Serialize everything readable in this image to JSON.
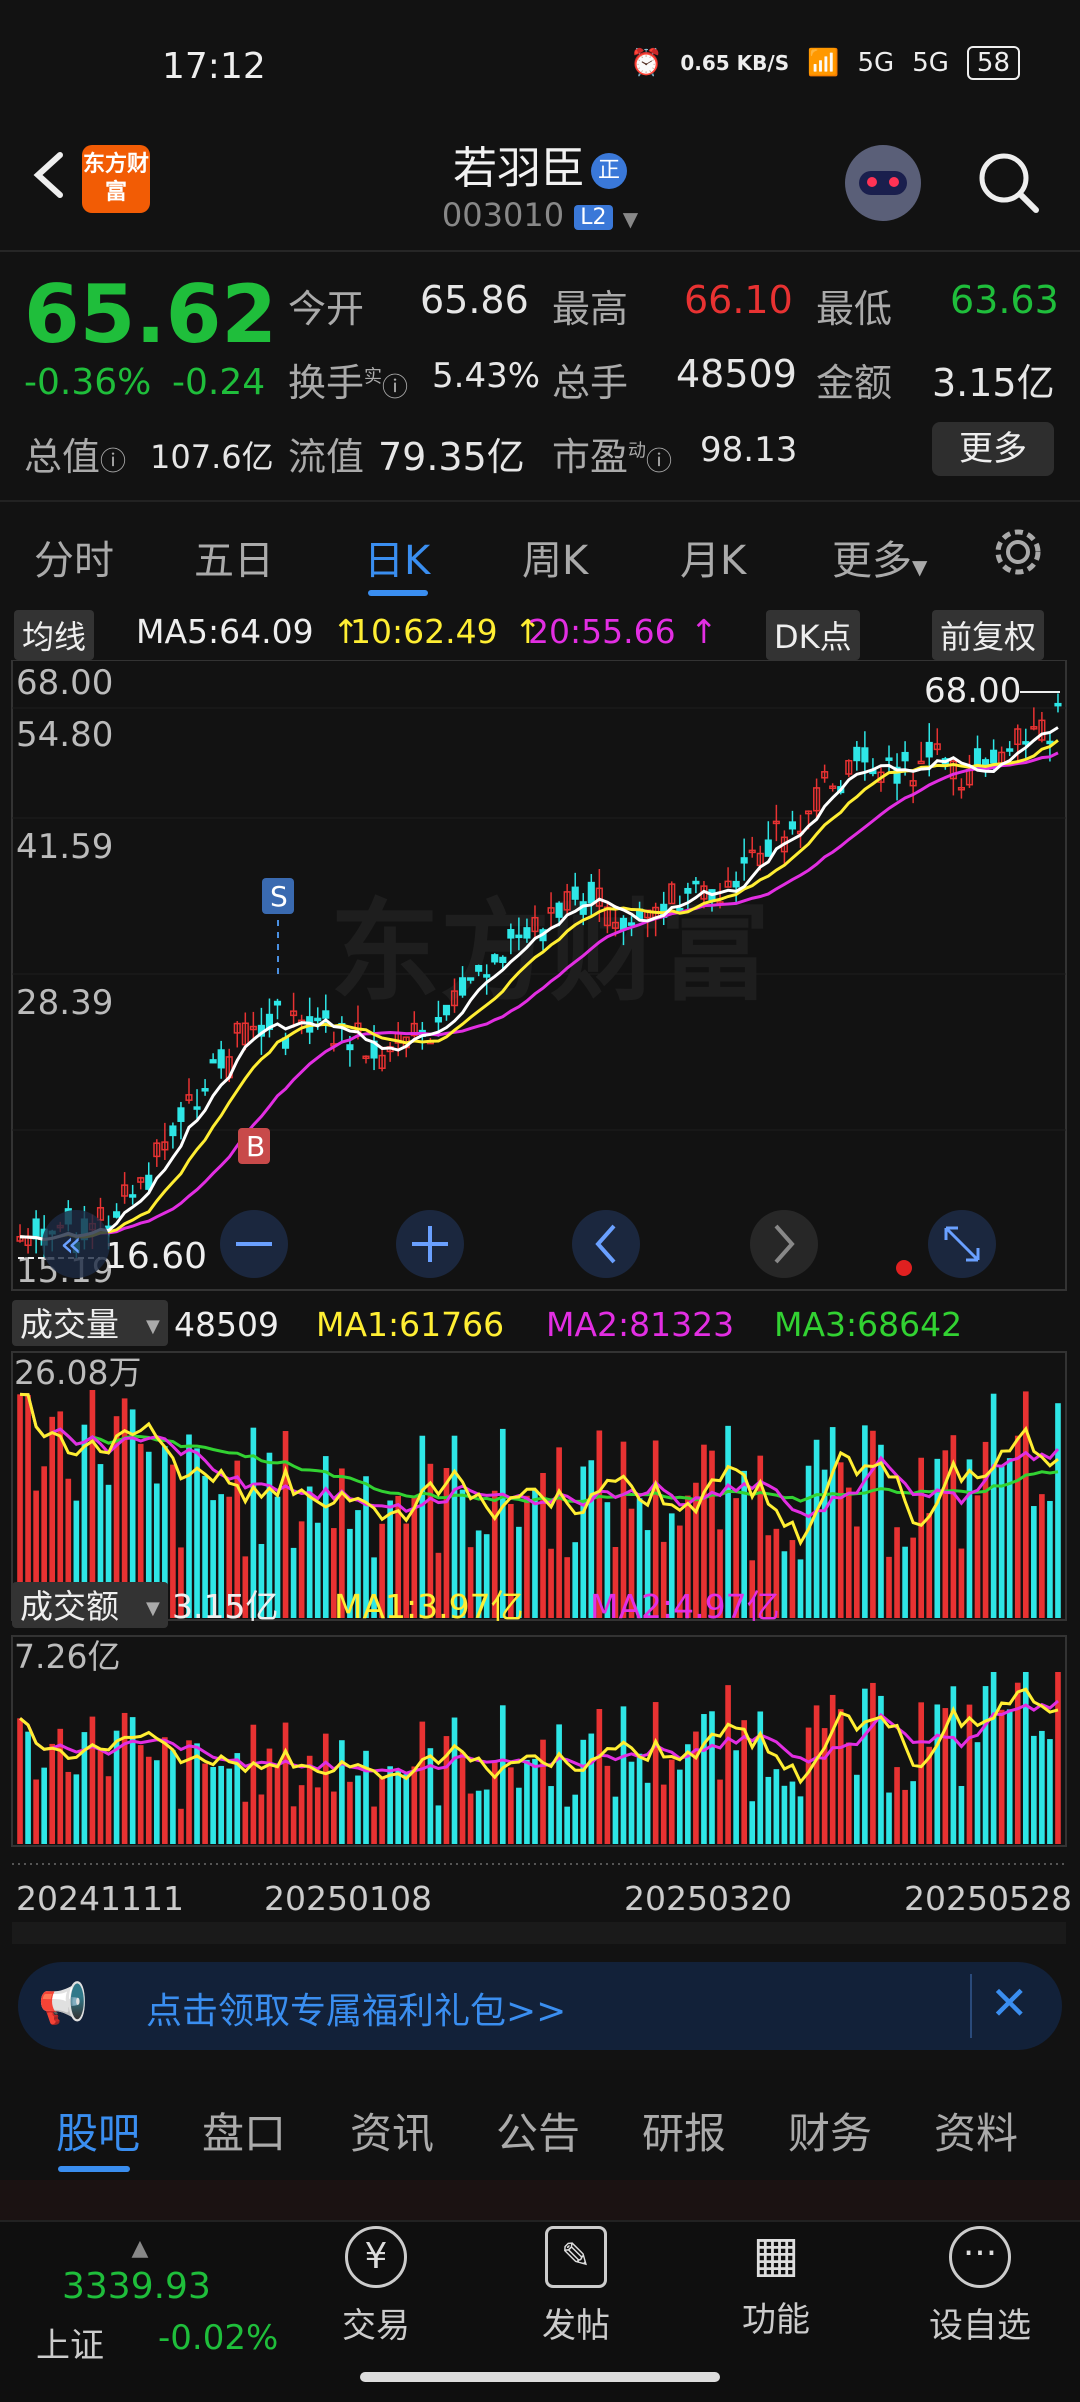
{
  "status": {
    "time": "17:12",
    "speed": "0.65 KB/S",
    "net1": "5G",
    "net2": "5G",
    "battery": "58"
  },
  "header": {
    "logo_text": "东方财富",
    "name": "若羽臣",
    "badge": "正",
    "code": "003010",
    "level": "L2"
  },
  "quote": {
    "price": "65.62",
    "pct": "-0.36%",
    "chg": "-0.24",
    "open_label": "今开",
    "open": "65.86",
    "high_label": "最高",
    "high": "66.10",
    "low_label": "最低",
    "low": "63.63",
    "turnover_label": "换手",
    "turnover_sup": "实",
    "turnover": "5.43%",
    "volume_label": "总手",
    "volume": "48509",
    "amount_label": "金额",
    "amount": "3.15亿",
    "mcap_label": "总值",
    "mcap": "107.6亿",
    "float_label": "流值",
    "float": "79.35亿",
    "pe_label": "市盈",
    "pe_sup": "动",
    "pe": "98.13",
    "more": "更多"
  },
  "tabs": [
    "分时",
    "五日",
    "日K",
    "周K",
    "月K",
    "更多"
  ],
  "ma_bar": {
    "btn": "均线",
    "ma5": "MA5:64.09",
    "ma10": "10:62.49",
    "ma20": "20:55.66",
    "dk": "DK点",
    "fq": "前复权"
  },
  "price_axis": [
    "68.00",
    "54.80",
    "41.59",
    "28.39",
    "15.19"
  ],
  "price_marks": {
    "high": "68.00",
    "low": "16.60",
    "s": "S",
    "b": "B"
  },
  "volume_bar": {
    "btn": "成交量",
    "val": "48509",
    "ma1": "MA1:61766",
    "ma2": "MA2:81323",
    "ma3": "MA3:68642",
    "axis": "26.08万"
  },
  "amount_bar": {
    "btn": "成交额",
    "val": "3.15亿",
    "ma1": "MA1:3.97亿",
    "ma2": "MA2:4.97亿",
    "axis": "7.26亿"
  },
  "dates": [
    "20241111",
    "20250108",
    "20250320",
    "20250528"
  ],
  "banner": {
    "text": "点击领取专属福利礼包>>"
  },
  "bottom_tabs": [
    "股吧",
    "盘口",
    "资讯",
    "公告",
    "研报",
    "财务",
    "资料"
  ],
  "index": {
    "value": "3339.93",
    "name": "上证",
    "pct": "-0.02%"
  },
  "bottom_nav": [
    {
      "icon": "¥",
      "label": "交易"
    },
    {
      "icon": "✎",
      "label": "发帖"
    },
    {
      "icon": "▦",
      "label": "功能"
    },
    {
      "icon": "···",
      "label": "设自选"
    }
  ],
  "colors": {
    "up": "#e83232",
    "down": "#1fbe3b",
    "accent": "#3a8ef0",
    "cyan": "#2ee6e6",
    "ma_yellow": "#ffee33",
    "ma_magenta": "#e22ee2"
  }
}
